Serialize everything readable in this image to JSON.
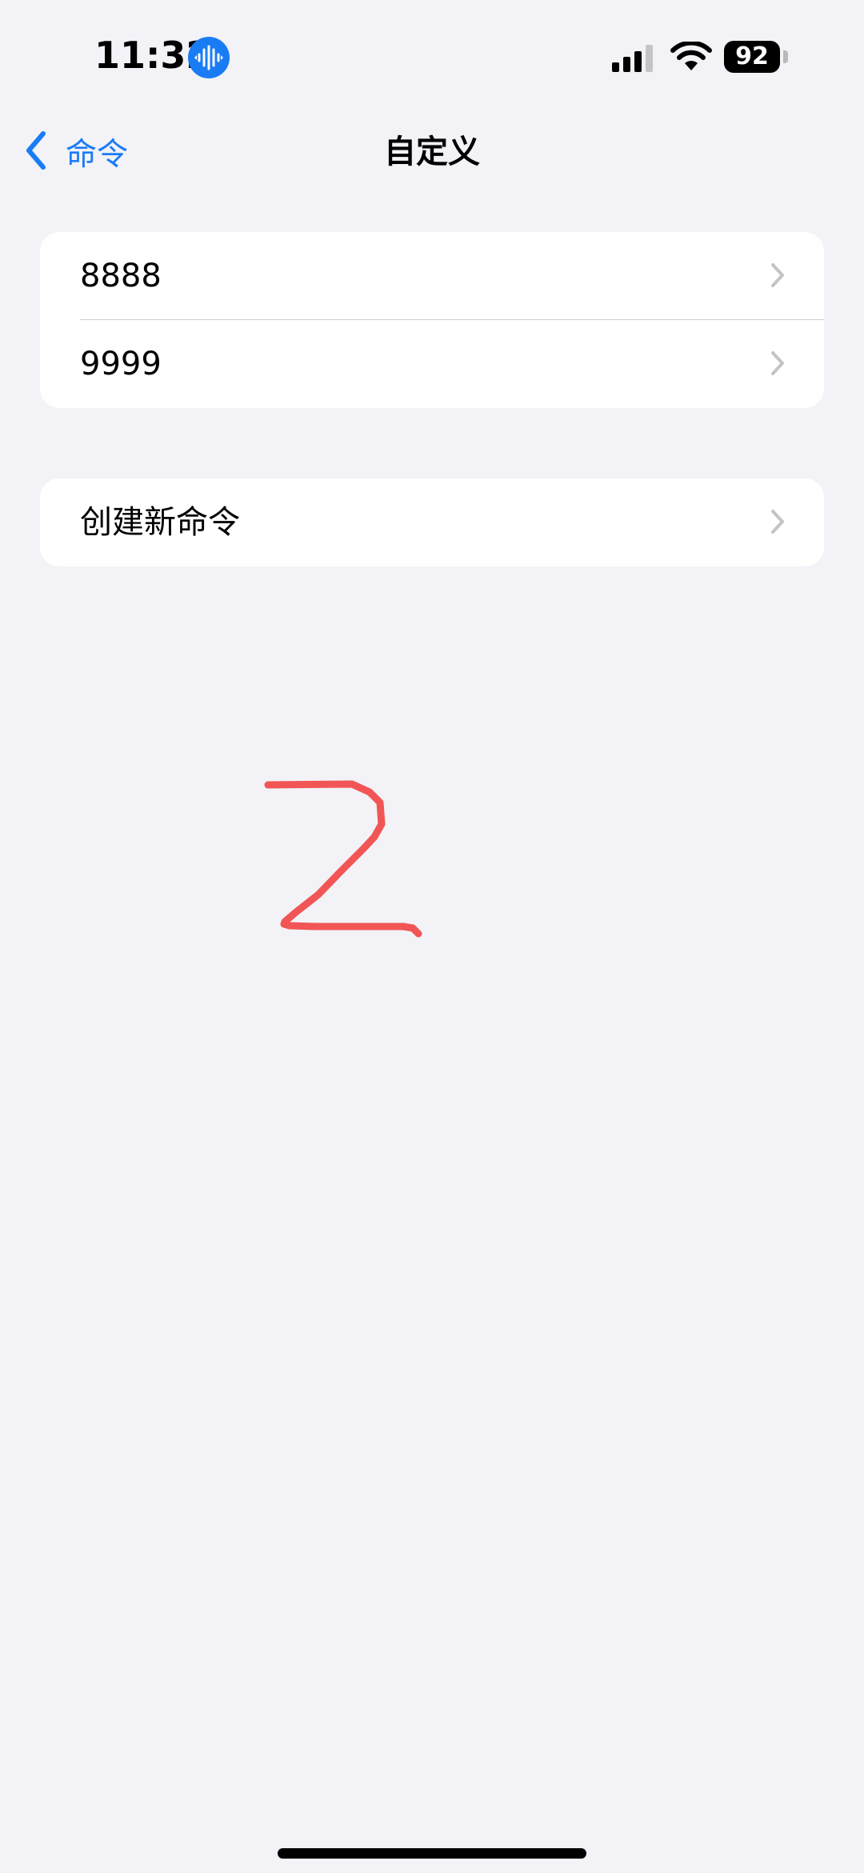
{
  "status_bar": {
    "time": "11:32",
    "battery_level": "92",
    "icons": [
      "voice-recording-icon",
      "cellular-signal-icon",
      "wifi-icon",
      "battery-icon"
    ]
  },
  "nav": {
    "back_label": "命令",
    "title": "自定义",
    "back_icon": "chevron-left-icon"
  },
  "commands": [
    {
      "label": "8888"
    },
    {
      "label": "9999"
    }
  ],
  "create": {
    "label": "创建新命令"
  },
  "colors": {
    "accent": "#1a7cf5",
    "background": "#f2f2f7",
    "annotation": "#f25555"
  }
}
